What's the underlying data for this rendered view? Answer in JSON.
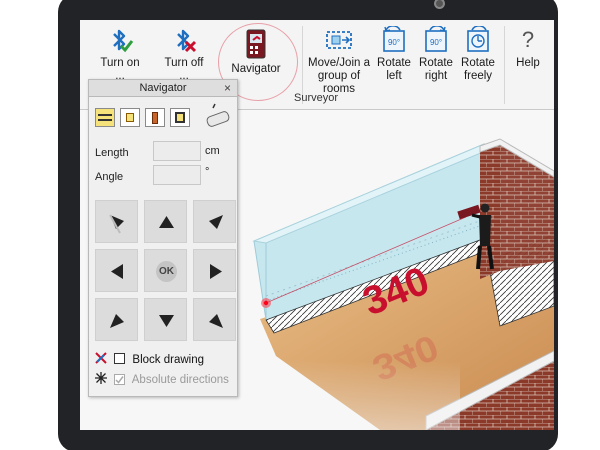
{
  "ribbon": {
    "buttons": [
      {
        "label": "Turn on",
        "label2": "..."
      },
      {
        "label": "Turn off",
        "label2": "..."
      },
      {
        "label": "Navigator"
      },
      {
        "label": "Move/Join a",
        "label2": "group of rooms"
      },
      {
        "label": "Rotate",
        "label2": "left"
      },
      {
        "label": "Rotate",
        "label2": "right"
      },
      {
        "label": "Rotate",
        "label2": "freely"
      },
      {
        "label": "Help"
      }
    ],
    "group_label": "Surveyor"
  },
  "navigator": {
    "title": "Navigator",
    "close_glyph": "×",
    "length_label": "Length",
    "length_unit": "cm",
    "angle_label": "Angle",
    "angle_unit": "°",
    "ok_label": "OK",
    "block_drawing_label": "Block drawing",
    "absolute_directions_label": "Absolute directions",
    "block_drawing_checked": false,
    "absolute_directions_checked": true
  },
  "scene": {
    "measurement": "340",
    "measurement_reflection": "340"
  },
  "colors": {
    "accent_red": "#c8102e",
    "bluetooth_blue": "#1f6fc0",
    "wall_glass": "#bfe3ec",
    "brick": "#8b3a2a",
    "floor_wood": "#d9a56b"
  }
}
